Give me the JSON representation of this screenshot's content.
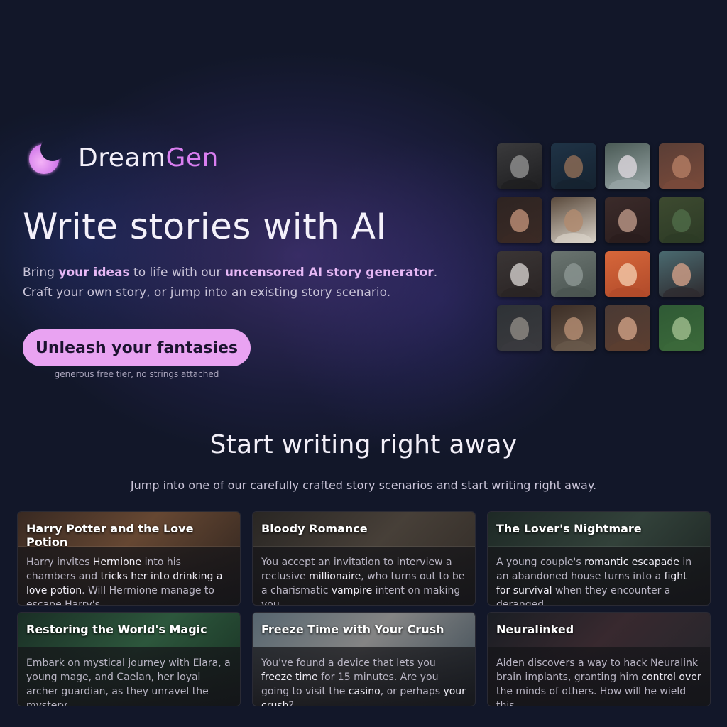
{
  "brand": {
    "name_part1": "Dream",
    "name_part2": "Gen",
    "logo_icon": "crescent-moon-icon",
    "accent_color": "#d97ef0"
  },
  "hero": {
    "title": "Write stories with AI",
    "subtitle_line1": [
      {
        "text": "Bring ",
        "hl": false
      },
      {
        "text": "your ideas",
        "hl": true
      },
      {
        "text": " to life with our ",
        "hl": false
      },
      {
        "text": "uncensored AI story generator",
        "hl": true
      },
      {
        "text": ".",
        "hl": false
      }
    ],
    "subtitle_line2": "Craft your own story, or jump into an existing story scenario.",
    "cta_label": "Unleash your fantasies",
    "cta_note": "generous free tier, no strings attached",
    "cta_color": "#e9a3f2"
  },
  "avatars": [
    {
      "name": "avatar-bearded-man-bw",
      "bg": "#3a3a3c",
      "face": "#8b8b8b",
      "body": "#1e1e20"
    },
    {
      "name": "avatar-warrior-man",
      "bg": "#1f3346",
      "face": "#8a6a55",
      "body": "#15222f"
    },
    {
      "name": "avatar-elf-woman",
      "bg": "#4a5a55",
      "face": "#d7d2d8",
      "body": "#9aa7a8"
    },
    {
      "name": "avatar-barbarian-woman",
      "bg": "#5a3e36",
      "face": "#b07a62",
      "body": "#7a4a3a"
    },
    {
      "name": "avatar-group-women",
      "bg": "#2e2422",
      "face": "#b68a72",
      "body": "#3a2a25"
    },
    {
      "name": "avatar-young-man",
      "bg": "#5a4a3c",
      "face": "#b08b70",
      "body": "#d9d2c8"
    },
    {
      "name": "avatar-vampire-man",
      "bg": "#3b2b2a",
      "face": "#b49181",
      "body": "#2a1d1d"
    },
    {
      "name": "avatar-dragon",
      "bg": "#3d4a30",
      "face": "#4d6a46",
      "body": "#2c3a25"
    },
    {
      "name": "avatar-white-haired-man",
      "bg": "#3a3535",
      "face": "#c9c4c2",
      "body": "#2a2424"
    },
    {
      "name": "avatar-city-car",
      "bg": "#6a7470",
      "face": "#8a9490",
      "body": "#4a5450"
    },
    {
      "name": "avatar-orange-hair-girl",
      "bg": "#d7673a",
      "face": "#f0c3a3",
      "body": "#b04a2a"
    },
    {
      "name": "avatar-brunette-woman",
      "bg": "#4a6a70",
      "face": "#c99a84",
      "body": "#2e2a2e"
    },
    {
      "name": "avatar-witcher",
      "bg": "#2e3236",
      "face": "#8a8580",
      "body": "#3a3a3e"
    },
    {
      "name": "avatar-bearded-young-man",
      "bg": "#3c2e26",
      "face": "#b08a70",
      "body": "#6a5a4c"
    },
    {
      "name": "avatar-curly-hair-woman",
      "bg": "#4a3a34",
      "face": "#c89a80",
      "body": "#5c3e30"
    },
    {
      "name": "avatar-nature-woman",
      "bg": "#2f5a35",
      "face": "#9ab88a",
      "body": "#3c6a3a"
    }
  ],
  "section": {
    "title": "Start writing right away",
    "subtitle": "Jump into one of our carefully crafted story scenarios and start writing right away."
  },
  "cards": [
    {
      "title": "Harry Potter and the Love Potion",
      "bg": "linear-gradient(135deg, #3a2a22 0%, #6a4a34 45%, #2c221d 100%)",
      "body": [
        {
          "text": "Harry invites ",
          "hl": false
        },
        {
          "text": "Hermione",
          "hl": true
        },
        {
          "text": " into his chambers and ",
          "hl": false
        },
        {
          "text": "tricks her into drinking a love potion",
          "hl": true
        },
        {
          "text": ". Will Hermione manage to escape Harry's…",
          "hl": false
        }
      ]
    },
    {
      "title": "Bloody Romance",
      "bg": "linear-gradient(135deg, #2a2724 0%, #4a423a 50%, #302a25 100%)",
      "body": [
        {
          "text": "You accept an invitation to interview a reclusive ",
          "hl": false
        },
        {
          "text": "millionaire",
          "hl": true
        },
        {
          "text": ", who turns out to be a charismatic ",
          "hl": false
        },
        {
          "text": "vampire",
          "hl": true
        },
        {
          "text": " intent on making you…",
          "hl": false
        }
      ]
    },
    {
      "title": "The Lover's Nightmare",
      "bg": "linear-gradient(135deg, #1e2a26 0%, #34443c 50%, #1a2220 100%)",
      "body": [
        {
          "text": "A young couple's ",
          "hl": false
        },
        {
          "text": "romantic escapade",
          "hl": true
        },
        {
          "text": " in an abandoned house turns into a ",
          "hl": false
        },
        {
          "text": "fight for survival",
          "hl": true
        },
        {
          "text": " when they encounter a deranged…",
          "hl": false
        }
      ]
    },
    {
      "title": "Restoring the World's Magic",
      "bg": "linear-gradient(135deg, #1a3026 0%, #2e5a3e 50%, #173022 100%)",
      "body": [
        {
          "text": "Embark on mystical journey with Elara, a young mage, and Caelan, her loyal archer guardian, as they unravel the mystery…",
          "hl": false
        }
      ]
    },
    {
      "title": "Freeze Time with Your Crush",
      "bg": "linear-gradient(135deg, #5a6a74 0%, #8a8a8a 45%, #3a4a55 100%)",
      "body": [
        {
          "text": "You've found a device that lets you ",
          "hl": false
        },
        {
          "text": "freeze time",
          "hl": true
        },
        {
          "text": " for 15 minutes. Are you going to visit the ",
          "hl": false
        },
        {
          "text": "casino",
          "hl": true
        },
        {
          "text": ", or perhaps ",
          "hl": false
        },
        {
          "text": "your crush",
          "hl": true
        },
        {
          "text": "?",
          "hl": false
        }
      ]
    },
    {
      "title": "Neuralinked",
      "bg": "linear-gradient(135deg, #1a1e24 0%, #3a2a30 45%, #22262c 100%)",
      "body": [
        {
          "text": "Aiden discovers a way to hack Neuralink brain implants, granting him ",
          "hl": false
        },
        {
          "text": "control over",
          "hl": true
        },
        {
          "text": " the minds of others. How will he wield this…",
          "hl": false
        }
      ]
    }
  ]
}
